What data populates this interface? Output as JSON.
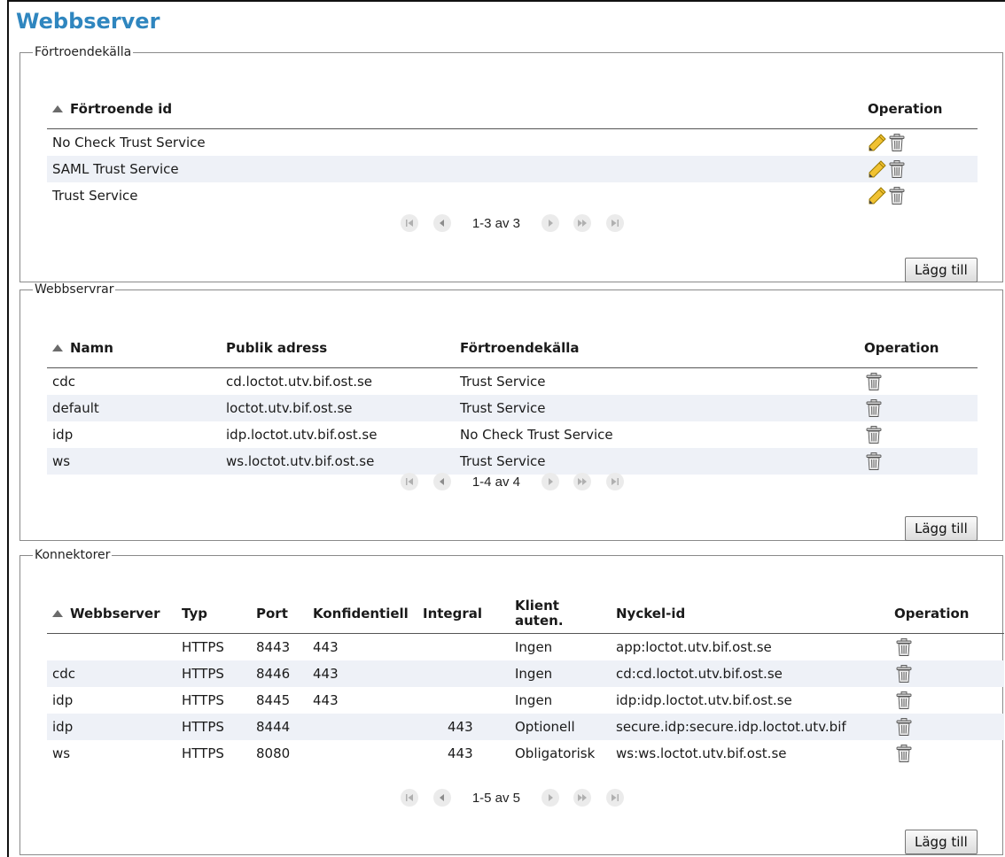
{
  "page_title": "Webbserver",
  "trust": {
    "legend": "Förtroendekälla",
    "headers": {
      "id": "Förtroende id",
      "operation": "Operation"
    },
    "rows": [
      {
        "id": "No Check Trust Service"
      },
      {
        "id": "SAML Trust Service"
      },
      {
        "id": "Trust Service"
      }
    ],
    "pager": "1-3 av 3",
    "add_label": "Lägg till"
  },
  "webservers": {
    "legend": "Webbservrar",
    "headers": {
      "name": "Namn",
      "address": "Publik adress",
      "trust": "Förtroendekälla",
      "operation": "Operation"
    },
    "rows": [
      {
        "name": "cdc",
        "address": "cd.loctot.utv.bif.ost.se",
        "trust": "Trust Service"
      },
      {
        "name": "default",
        "address": "loctot.utv.bif.ost.se",
        "trust": "Trust Service"
      },
      {
        "name": "idp",
        "address": "idp.loctot.utv.bif.ost.se",
        "trust": "No Check Trust Service"
      },
      {
        "name": "ws",
        "address": "ws.loctot.utv.bif.ost.se",
        "trust": "Trust Service"
      }
    ],
    "pager": "1-4 av 4",
    "add_label": "Lägg till"
  },
  "connectors": {
    "legend": "Konnektorer",
    "headers": {
      "webserver": "Webbserver",
      "type": "Typ",
      "port": "Port",
      "confidential": "Konfidentiell",
      "integral": "Integral",
      "client_auth_1": "Klient",
      "client_auth_2": "auten.",
      "key_id": "Nyckel-id",
      "operation": "Operation"
    },
    "rows": [
      {
        "webserver": "",
        "type": "HTTPS",
        "port": "8443",
        "confidential": "443",
        "integral": "",
        "client_auth": "Ingen",
        "key_id": "app:loctot.utv.bif.ost.se"
      },
      {
        "webserver": "cdc",
        "type": "HTTPS",
        "port": "8446",
        "confidential": "443",
        "integral": "",
        "client_auth": "Ingen",
        "key_id": "cd:cd.loctot.utv.bif.ost.se"
      },
      {
        "webserver": "idp",
        "type": "HTTPS",
        "port": "8445",
        "confidential": "443",
        "integral": "",
        "client_auth": "Ingen",
        "key_id": "idp:idp.loctot.utv.bif.ost.se"
      },
      {
        "webserver": "idp",
        "type": "HTTPS",
        "port": "8444",
        "confidential": "",
        "integral": "443",
        "client_auth": "Optionell",
        "key_id": "secure.idp:secure.idp.loctot.utv.bif"
      },
      {
        "webserver": "ws",
        "type": "HTTPS",
        "port": "8080",
        "confidential": "",
        "integral": "443",
        "client_auth": "Obligatorisk",
        "key_id": "ws:ws.loctot.utv.bif.ost.se"
      }
    ],
    "pager": "1-5 av 5",
    "add_label": "Lägg till"
  },
  "icons": {
    "edit": "pencil-icon",
    "delete": "trash-icon",
    "sort": "sort-up-icon"
  },
  "colors": {
    "title": "#2f86bf",
    "row_alt": "#eef1f7",
    "pencil": "#e8b400"
  }
}
